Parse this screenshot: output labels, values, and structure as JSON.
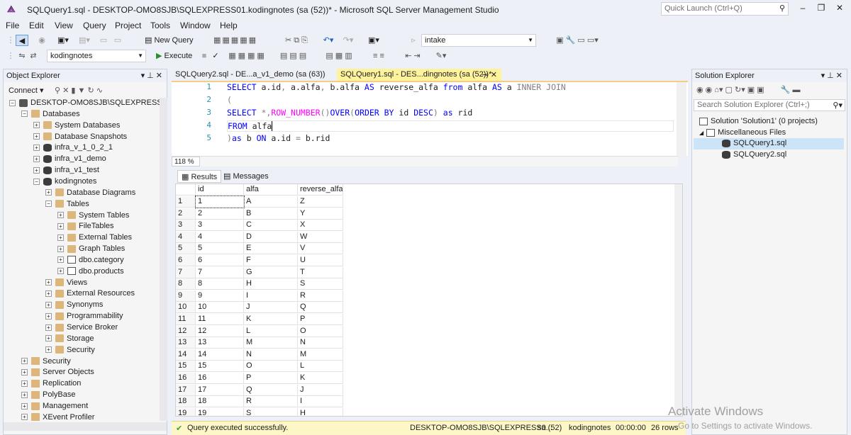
{
  "window": {
    "title": "SQLQuery1.sql - DESKTOP-OMO8SJB\\SQLEXPRESS01.kodingnotes (sa (52))* - Microsoft SQL Server Management Studio",
    "quick_launch_placeholder": "Quick Launch (Ctrl+Q)",
    "controls": {
      "minimize": "–",
      "maximize": "❐",
      "close": "✕"
    }
  },
  "menu": [
    "File",
    "Edit",
    "View",
    "Query",
    "Project",
    "Tools",
    "Window",
    "Help"
  ],
  "toolbar1": {
    "new_query_label": "New Query",
    "database_combo_value": "intake"
  },
  "toolbar2": {
    "database_value": "kodingnotes",
    "execute_label": "Execute"
  },
  "object_explorer": {
    "title": "Object Explorer",
    "connect_label": "Connect",
    "tree": [
      {
        "label": "DESKTOP-OMO8SJB\\SQLEXPRESS01 (S",
        "level": 0,
        "exp": "−",
        "icon": "server"
      },
      {
        "label": "Databases",
        "level": 1,
        "exp": "−",
        "icon": "folder"
      },
      {
        "label": "System Databases",
        "level": 2,
        "exp": "+",
        "icon": "folder"
      },
      {
        "label": "Database Snapshots",
        "level": 2,
        "exp": "+",
        "icon": "folder"
      },
      {
        "label": "infra_v_1_0_2_1",
        "level": 2,
        "exp": "+",
        "icon": "db"
      },
      {
        "label": "infra_v1_demo",
        "level": 2,
        "exp": "+",
        "icon": "db"
      },
      {
        "label": "infra_v1_test",
        "level": 2,
        "exp": "+",
        "icon": "db"
      },
      {
        "label": "kodingnotes",
        "level": 2,
        "exp": "−",
        "icon": "db"
      },
      {
        "label": "Database Diagrams",
        "level": 3,
        "exp": "+",
        "icon": "folder"
      },
      {
        "label": "Tables",
        "level": 3,
        "exp": "−",
        "icon": "folder"
      },
      {
        "label": "System Tables",
        "level": 4,
        "exp": "+",
        "icon": "folder"
      },
      {
        "label": "FileTables",
        "level": 4,
        "exp": "+",
        "icon": "folder"
      },
      {
        "label": "External Tables",
        "level": 4,
        "exp": "+",
        "icon": "folder"
      },
      {
        "label": "Graph Tables",
        "level": 4,
        "exp": "+",
        "icon": "folder"
      },
      {
        "label": "dbo.category",
        "level": 4,
        "exp": "+",
        "icon": "table"
      },
      {
        "label": "dbo.products",
        "level": 4,
        "exp": "+",
        "icon": "table"
      },
      {
        "label": "Views",
        "level": 3,
        "exp": "+",
        "icon": "folder"
      },
      {
        "label": "External Resources",
        "level": 3,
        "exp": "+",
        "icon": "folder"
      },
      {
        "label": "Synonyms",
        "level": 3,
        "exp": "+",
        "icon": "folder"
      },
      {
        "label": "Programmability",
        "level": 3,
        "exp": "+",
        "icon": "folder"
      },
      {
        "label": "Service Broker",
        "level": 3,
        "exp": "+",
        "icon": "folder"
      },
      {
        "label": "Storage",
        "level": 3,
        "exp": "+",
        "icon": "folder"
      },
      {
        "label": "Security",
        "level": 3,
        "exp": "+",
        "icon": "folder"
      },
      {
        "label": "Security",
        "level": 1,
        "exp": "+",
        "icon": "folder"
      },
      {
        "label": "Server Objects",
        "level": 1,
        "exp": "+",
        "icon": "folder"
      },
      {
        "label": "Replication",
        "level": 1,
        "exp": "+",
        "icon": "folder"
      },
      {
        "label": "PolyBase",
        "level": 1,
        "exp": "+",
        "icon": "folder"
      },
      {
        "label": "Management",
        "level": 1,
        "exp": "+",
        "icon": "folder"
      },
      {
        "label": "XEvent Profiler",
        "level": 1,
        "exp": "+",
        "icon": "folder"
      }
    ]
  },
  "doc_tabs": [
    {
      "label": "SQLQuery2.sql - DE...a_v1_demo (sa (63))",
      "active": false
    },
    {
      "label": "SQLQuery1.sql - DES...dingnotes (sa (52))*",
      "active": true
    }
  ],
  "editor": {
    "line_numbers": [
      "1",
      "2",
      "3",
      "4",
      "5"
    ],
    "zoom": "118 %"
  },
  "results": {
    "tab_results": "Results",
    "tab_messages": "Messages",
    "columns": [
      "id",
      "alfa",
      "reverse_alfa"
    ],
    "rows": [
      [
        "1",
        "1",
        "A",
        "Z"
      ],
      [
        "2",
        "2",
        "B",
        "Y"
      ],
      [
        "3",
        "3",
        "C",
        "X"
      ],
      [
        "4",
        "4",
        "D",
        "W"
      ],
      [
        "5",
        "5",
        "E",
        "V"
      ],
      [
        "6",
        "6",
        "F",
        "U"
      ],
      [
        "7",
        "7",
        "G",
        "T"
      ],
      [
        "8",
        "8",
        "H",
        "S"
      ],
      [
        "9",
        "9",
        "I",
        "R"
      ],
      [
        "10",
        "10",
        "J",
        "Q"
      ],
      [
        "11",
        "11",
        "K",
        "P"
      ],
      [
        "12",
        "12",
        "L",
        "O"
      ],
      [
        "13",
        "13",
        "M",
        "N"
      ],
      [
        "14",
        "14",
        "N",
        "M"
      ],
      [
        "15",
        "15",
        "O",
        "L"
      ],
      [
        "16",
        "16",
        "P",
        "K"
      ],
      [
        "17",
        "17",
        "Q",
        "J"
      ],
      [
        "18",
        "18",
        "R",
        "I"
      ],
      [
        "19",
        "19",
        "S",
        "H"
      ]
    ]
  },
  "status": {
    "message": "Query executed successfully.",
    "server": "DESKTOP-OMO8SJB\\SQLEXPRESS0...",
    "user": "sa (52)",
    "database": "kodingnotes",
    "time": "00:00:00",
    "rows": "26 rows"
  },
  "solution_explorer": {
    "title": "Solution Explorer",
    "search_placeholder": "Search Solution Explorer (Ctrl+;)",
    "solution": "Solution 'Solution1' (0 projects)",
    "folder": "Miscellaneous Files",
    "files": [
      "SQLQuery1.sql",
      "SQLQuery2.sql"
    ]
  },
  "watermark": {
    "line1": "Activate Windows",
    "line2": "Go to Settings to activate Windows."
  },
  "colors": {
    "status_ok": "#3ca03c",
    "active_tab": "#fff29d",
    "keyword": "#0000ff"
  }
}
